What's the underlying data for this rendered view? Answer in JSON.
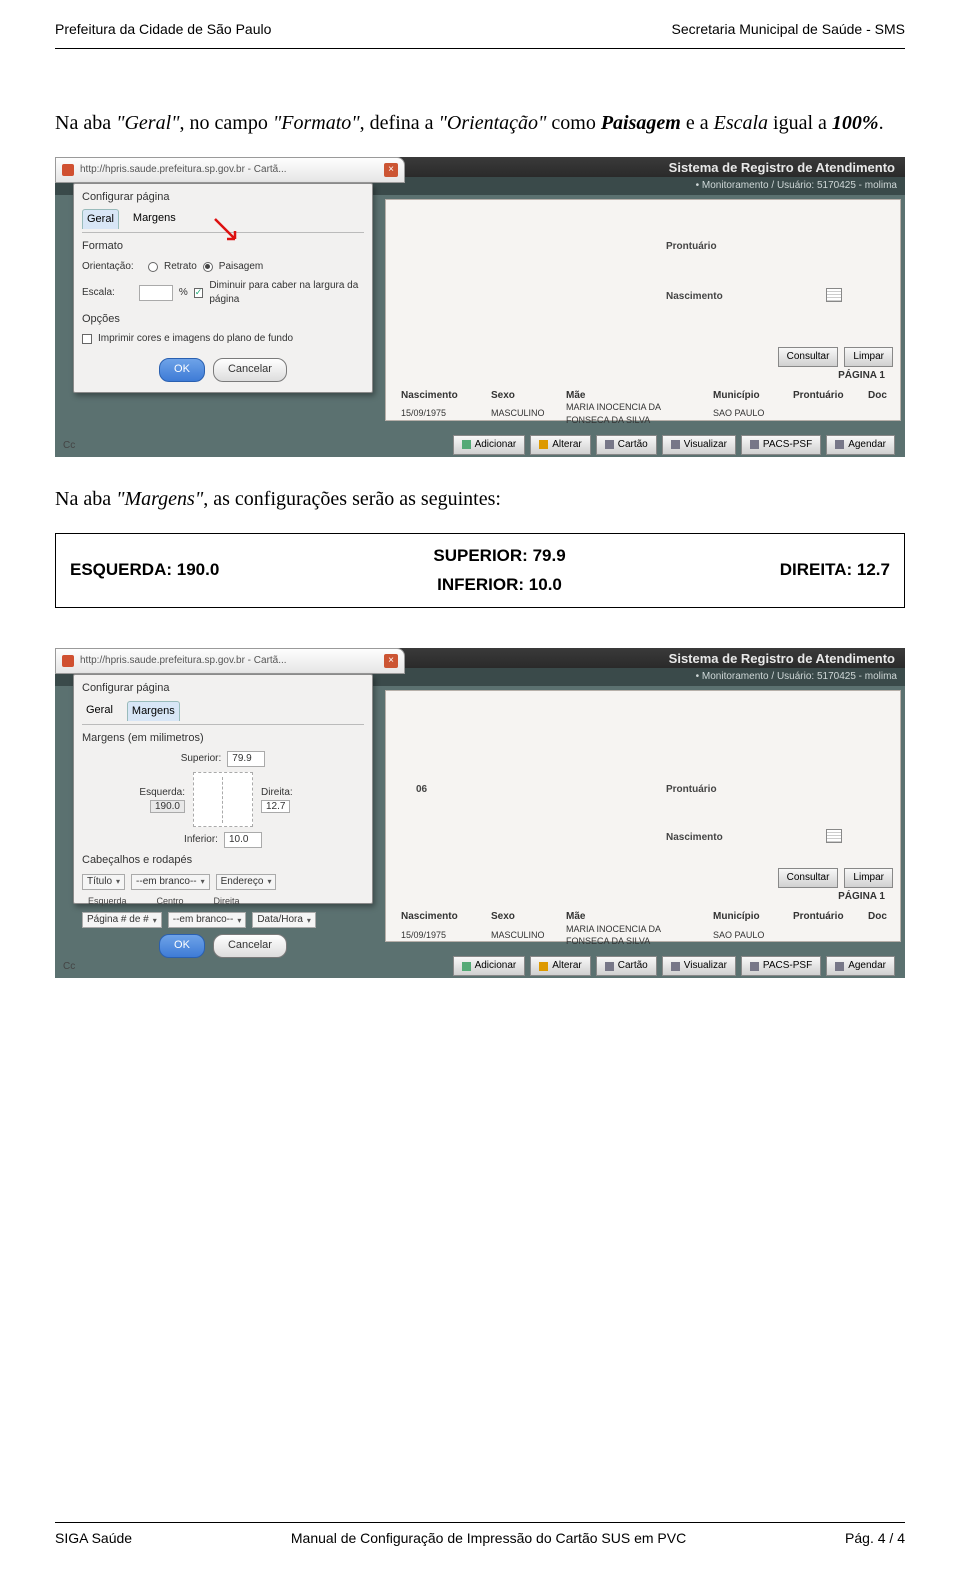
{
  "header": {
    "left": "Prefeitura da Cidade de São Paulo",
    "right": "Secretaria Municipal de Saúde - SMS"
  },
  "para1": {
    "pre": "Na aba ",
    "tab": "\"Geral\"",
    "mid": ", no campo ",
    "field": "\"Formato\"",
    "post1": ", defina a ",
    "orient_word": "\"Orientação\"",
    "as": " como ",
    "orient_val": "Paisagem",
    "post2": " e a ",
    "scale_word": "Escala",
    "equal": " igual a ",
    "scale_val": "100%"
  },
  "screenshot1": {
    "browser_url": "http://hpris.saude.prefeitura.sp.gov.br - Cartã...",
    "dialog_title": "Configurar página",
    "tabs": {
      "geral": "Geral",
      "margens": "Margens"
    },
    "section_formato": "Formato",
    "orientacao_label": "Orientação:",
    "radio_retrato": "Retrato",
    "radio_paisagem": "Paisagem",
    "escala_label": "Escala:",
    "percent": "%",
    "diminuir": "Diminuir para caber na largura da página",
    "section_opcoes": "Opções",
    "imprimir_cores": "Imprimir cores e imagens do plano de fundo",
    "app_title": "Sistema de Registro de Atendimento",
    "subbar": "• Monitoramento / Usuário: 5170425 - molima",
    "bg": {
      "prontuario": "Prontuário",
      "nascimento_lbl": "Nascimento",
      "cc": "Cc"
    },
    "btn_consultar": "Consultar",
    "btn_limpar": "Limpar",
    "pagina": "PÁGINA 1",
    "head": {
      "nasc": "Nascimento",
      "sexo": "Sexo",
      "mae": "Mãe",
      "mun": "Município",
      "pront": "Prontuário",
      "doc": "Doc"
    },
    "row": {
      "nasc": "15/09/1975",
      "sexo": "MASCULINO",
      "mae": "MARIA INOCENCIA DA FONSECA DA SILVA",
      "mun": "SAO PAULO"
    },
    "bottom": {
      "adicionar": "Adicionar",
      "alterar": "Alterar",
      "cartao": "Cartão",
      "visualizar": "Visualizar",
      "pacs": "PACS-PSF",
      "agendar": "Agendar"
    },
    "ok": "OK",
    "cancelar": "Cancelar"
  },
  "para2": {
    "pre": "Na aba ",
    "tab": "\"Margens\"",
    "post": ", as configurações serão as seguintes:"
  },
  "margins": {
    "left_label": "ESQUERDA:",
    "left_val": "190.0",
    "right_label": "DIREITA:",
    "right_val": "12.7",
    "top_label": "SUPERIOR:",
    "top_val": "79.9",
    "bottom_label": "INFERIOR:",
    "bottom_val": "10.0"
  },
  "screenshot2": {
    "browser_url": "http://hpris.saude.prefeitura.sp.gov.br - Cartã...",
    "dialog_title": "Configurar página",
    "tabs": {
      "geral": "Geral",
      "margens": "Margens"
    },
    "margens_unit": "Margens (em milimetros)",
    "sup": "Superior:",
    "sup_v": "79.9",
    "esq": "Esquerda:",
    "esq_v": "190.0",
    "dir": "Direita:",
    "dir_v": "12.7",
    "inf": "Inferior:",
    "inf_v": "10.0",
    "cab": "Cabeçalhos e rodapés",
    "sel_titulo": "Título",
    "sel_branco": "--em branco--",
    "sel_endereco": "Endereço",
    "sel_esquerda": "Esquerda",
    "sel_centro": "Centro",
    "sel_direita": "Direita",
    "sel_pagina": "Página # de #",
    "sel_datahora": "Data/Hora",
    "app_title": "Sistema de Registro de Atendimento",
    "subbar": "• Monitoramento / Usuário: 5170425 - molima",
    "bg": {
      "prontuario": "Prontuário",
      "nascimento_lbl": "Nascimento",
      "cc": "Cc",
      "num": "06"
    },
    "btn_consultar": "Consultar",
    "btn_limpar": "Limpar",
    "pagina": "PÁGINA 1",
    "head": {
      "nasc": "Nascimento",
      "sexo": "Sexo",
      "mae": "Mãe",
      "mun": "Município",
      "pront": "Prontuário",
      "doc": "Doc"
    },
    "row": {
      "nasc": "15/09/1975",
      "sexo": "MASCULINO",
      "mae": "MARIA INOCENCIA DA FONSECA DA SILVA",
      "mun": "SAO PAULO"
    },
    "bottom": {
      "adicionar": "Adicionar",
      "alterar": "Alterar",
      "cartao": "Cartão",
      "visualizar": "Visualizar",
      "pacs": "PACS-PSF",
      "agendar": "Agendar"
    },
    "ok": "OK",
    "cancelar": "Cancelar"
  },
  "footer": {
    "left": "SIGA Saúde",
    "center": "Manual de Configuração de Impressão do Cartão SUS em PVC",
    "right": "Pág. 4 / 4"
  }
}
